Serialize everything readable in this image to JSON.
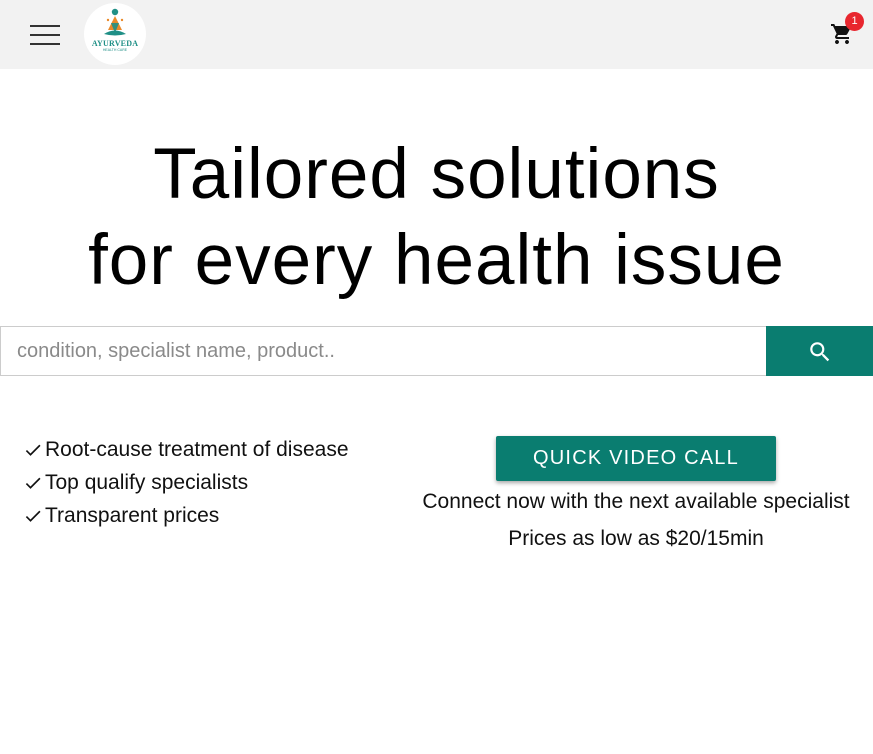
{
  "header": {
    "menu_icon": "hamburger-menu-icon",
    "logo": {
      "text": "AYURVEDA",
      "subtext": "HEALTH CARE"
    },
    "cart": {
      "icon": "shopping-cart-icon",
      "count": "1",
      "badge_color": "#e8262e"
    }
  },
  "hero": {
    "line1": "Tailored solutions",
    "line2": "for every health issue"
  },
  "search": {
    "placeholder": "condition, specialist name, product..",
    "button_icon": "search-icon",
    "accent_color": "#0a7d70"
  },
  "features": {
    "icon": "checkmark-icon",
    "items": [
      "Root-cause treatment of disease",
      "Top qualify specialists",
      "Transparent prices"
    ]
  },
  "video_call": {
    "button_label": "QUICK VIDEO CALL",
    "subtitle": "Connect now with the next available specialist",
    "price_text": "Prices as low as $20/15min"
  }
}
